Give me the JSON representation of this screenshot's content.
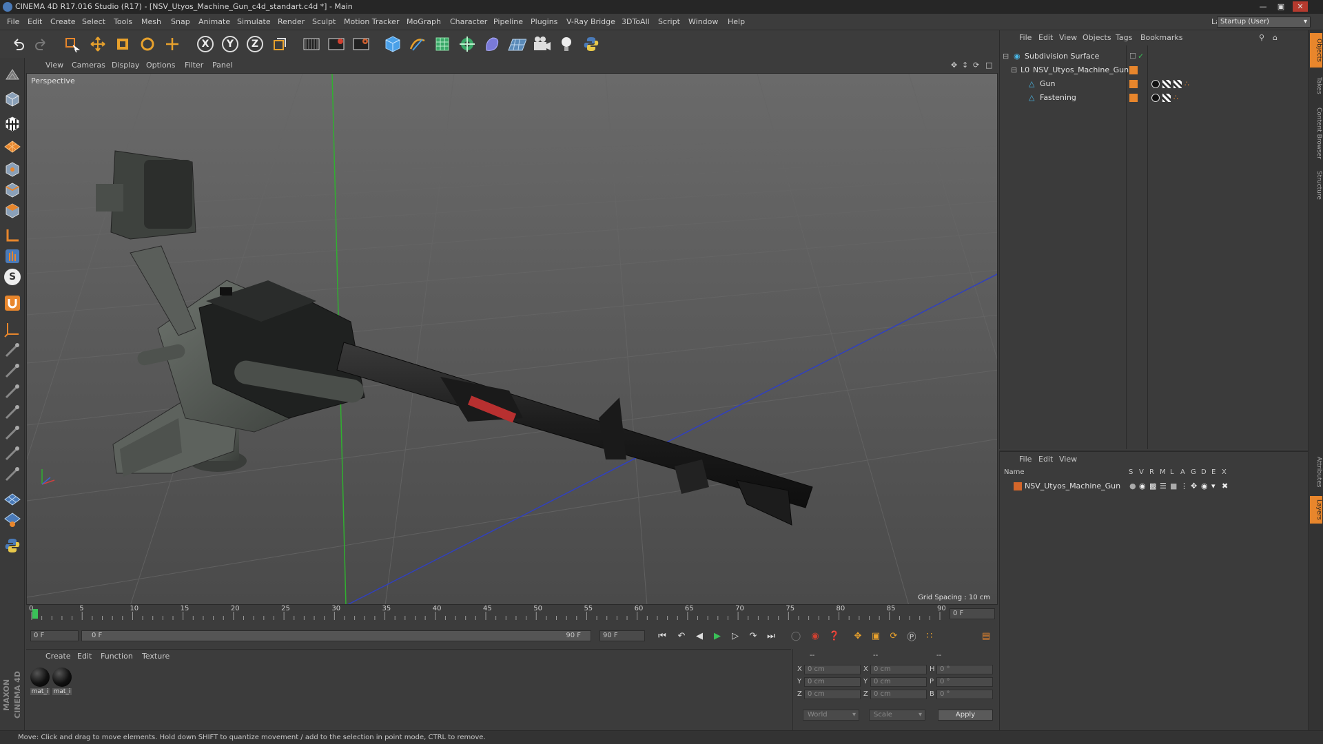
{
  "window": {
    "title": "CINEMA 4D R17.016 Studio (R17) - [NSV_Utyos_Machine_Gun_c4d_standart.c4d *] - Main",
    "buttons": [
      "minimize-icon",
      "maximize-icon",
      "close-icon"
    ]
  },
  "menubar": {
    "items": [
      "File",
      "Edit",
      "Create",
      "Select",
      "Tools",
      "Mesh",
      "Snap",
      "Animate",
      "Simulate",
      "Render",
      "Sculpt",
      "Motion Tracker",
      "MoGraph",
      "Character",
      "Pipeline",
      "Plugins",
      "V-Ray Bridge",
      "3DToAll",
      "Script",
      "Window",
      "Help"
    ],
    "layout_label": "Layout:",
    "layout_value": "Startup (User)"
  },
  "toolbar": {
    "icons": [
      "undo-icon",
      "redo-icon",
      "live-selection-icon",
      "move-icon",
      "scale-icon",
      "rotate-icon",
      "recent-tool-icon",
      "x-axis-icon",
      "y-axis-icon",
      "z-axis-icon",
      "world-coordinates-icon",
      "render-view-icon",
      "render-picture-viewer-icon",
      "edit-render-settings-icon",
      "cube-object-icon",
      "spline-pen-icon",
      "subdivision-surface-icon",
      "cloner-icon",
      "deformer-icon",
      "floor-icon",
      "camera-icon",
      "light-icon",
      "python-icon"
    ],
    "axis_letters": [
      "X",
      "Y",
      "Z"
    ]
  },
  "lefttools": {
    "icons": [
      "make-editable-icon",
      "model-mode-icon",
      "texture-mode-icon",
      "workplane-icon",
      "points-mode-icon",
      "edges-mode-icon",
      "polygons-mode-icon",
      "axis-mode-icon",
      "tweak-mode-icon",
      "solo-icon",
      "magnet-icon",
      "coordinate-system-icon",
      "brush-1-icon",
      "brush-2-icon",
      "brush-3-icon",
      "brush-4-icon",
      "brush-5-icon",
      "brush-6-icon",
      "brush-7-icon",
      "snap-icon",
      "lock-workplane-icon",
      "python-script-icon"
    ],
    "solo_letter": "S"
  },
  "viewport": {
    "menu": [
      "View",
      "Cameras",
      "Display",
      "Options",
      "Filter",
      "Panel"
    ],
    "camera_label": "Perspective",
    "grid_spacing": "Grid Spacing : 10 cm",
    "nav_icons": [
      "pan-icon",
      "dolly-icon",
      "orbit-icon",
      "maximize-viewport-icon"
    ]
  },
  "timeline": {
    "ticks": [
      "0",
      "5",
      "10",
      "15",
      "20",
      "25",
      "30",
      "35",
      "40",
      "45",
      "50",
      "55",
      "60",
      "65",
      "70",
      "75",
      "80",
      "85",
      "90"
    ],
    "current_frame_field": "0 F"
  },
  "playbar": {
    "start_field": "0 F",
    "range_start": "0 F",
    "range_end": "90 F",
    "end_field": "90 F",
    "controls": [
      "go-to-start-icon",
      "previous-key-icon",
      "previous-frame-icon",
      "play-forward-icon",
      "next-frame-icon",
      "next-key-icon",
      "go-to-end-icon"
    ],
    "record_icons": [
      "record-keys-icon",
      "autokey-icon",
      "keyframe-selection-icon",
      "position-key-icon",
      "scale-key-icon",
      "rotation-key-icon",
      "parameter-key-icon",
      "pla-key-icon",
      "timeline-icon"
    ]
  },
  "material_manager": {
    "menu": [
      "Create",
      "Edit",
      "Function",
      "Texture"
    ],
    "materials": [
      {
        "label": "mat_i"
      },
      {
        "label": "mat_i"
      }
    ]
  },
  "coordinates": {
    "headers": [
      "--",
      "--",
      "--"
    ],
    "rows": [
      {
        "pos_label": "X",
        "pos_value": "0 cm",
        "size_label": "X",
        "size_value": "0 cm",
        "rot_label": "H",
        "rot_value": "0 °"
      },
      {
        "pos_label": "Y",
        "pos_value": "0 cm",
        "size_label": "Y",
        "size_value": "0 cm",
        "rot_label": "P",
        "rot_value": "0 °"
      },
      {
        "pos_label": "Z",
        "pos_value": "0 cm",
        "size_label": "Z",
        "size_value": "0 cm",
        "rot_label": "B",
        "rot_value": "0 °"
      }
    ],
    "mode_dropdown": "World",
    "size_dropdown": "Scale",
    "apply_label": "Apply"
  },
  "object_manager": {
    "menu": [
      "File",
      "Edit",
      "View",
      "Objects",
      "Tags",
      "Bookmarks"
    ],
    "objects": [
      {
        "name": "Subdivision Surface",
        "indent": 0
      },
      {
        "name": "NSV_Utyos_Machine_Gun",
        "indent": 1
      },
      {
        "name": "Gun",
        "indent": 2
      },
      {
        "name": "Fastening",
        "indent": 2
      }
    ]
  },
  "layer_manager": {
    "menu": [
      "File",
      "Edit",
      "View"
    ],
    "columns": [
      "Name",
      "S",
      "V",
      "R",
      "M",
      "L",
      "A",
      "G",
      "D",
      "E",
      "X"
    ],
    "layers": [
      {
        "name": "NSV_Utyos_Machine_Gun",
        "color": "#d4662a"
      }
    ]
  },
  "right_tabs": [
    "Objects",
    "Takes",
    "Content Browser",
    "Structure",
    "Attributes",
    "Layers"
  ],
  "status": {
    "text": "Move: Click and drag to move elements. Hold down SHIFT to quantize movement / add to the selection in point mode, CTRL to remove."
  },
  "brand": {
    "text": "MAXON CINEMA 4D"
  },
  "colors": {
    "accent_orange": "#e8862c",
    "layer_orange": "#d4662a",
    "x_axis": "#d04040",
    "y_axis": "#40c040",
    "z_axis": "#4060d0"
  }
}
